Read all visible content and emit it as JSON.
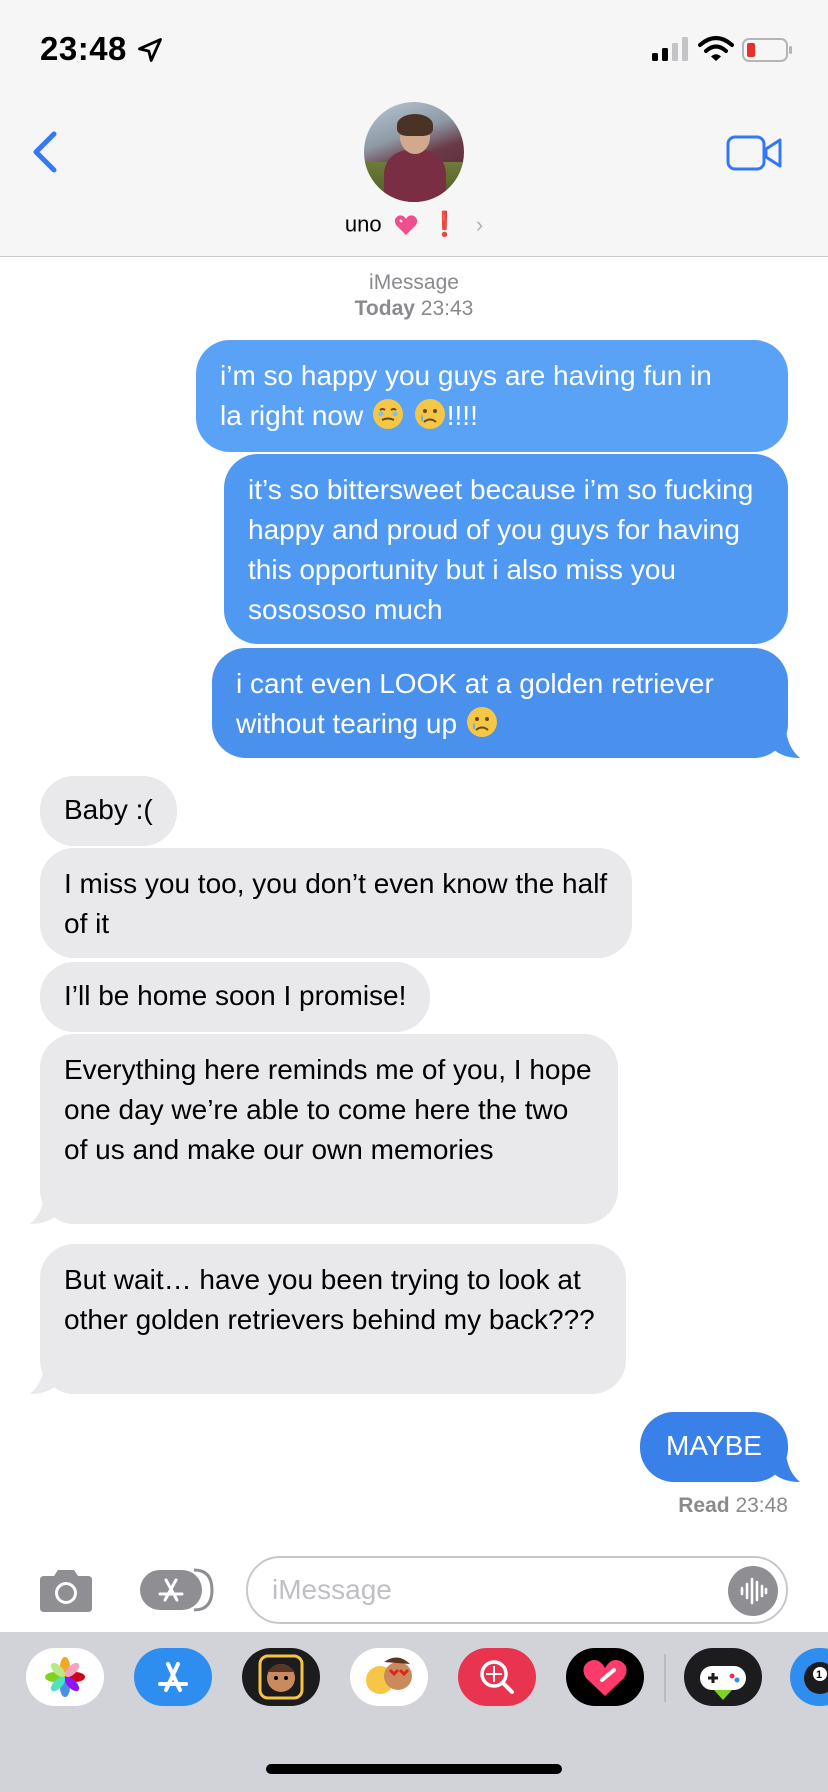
{
  "status_bar": {
    "time": "23:48"
  },
  "header": {
    "contact_name": "uno",
    "emoji_heart": "💖",
    "emoji_exclamation": "❗",
    "chevron": "›"
  },
  "thread": {
    "service": "iMessage",
    "date_label": "Today",
    "date_time": "23:43",
    "messages": [
      {
        "from": "me",
        "parts": [
          "i’m so happy you guys are having fun in",
          "la right now "
        ],
        "trailing": "!!!!"
      },
      {
        "from": "me",
        "text": "it’s so bittersweet because i’m so fucking happy and proud of you guys for having this opportunity but i also miss you sosososo much"
      },
      {
        "from": "me",
        "text": "i cant even LOOK at a golden retriever without tearing up "
      },
      {
        "from": "them",
        "text": "Baby :("
      },
      {
        "from": "them",
        "text": "I miss you too, you don’t even know the half of it"
      },
      {
        "from": "them",
        "text": "I’ll be home soon I promise!"
      },
      {
        "from": "them",
        "text": "Everything here reminds me of you, I hope one day we’re able to come here the two of us and make our own memories"
      },
      {
        "from": "them",
        "text": "But wait… have you been trying to look at other golden retrievers behind my back???"
      },
      {
        "from": "me",
        "text": "MAYBE"
      }
    ],
    "read_label": "Read",
    "read_time": "23:48"
  },
  "input": {
    "placeholder": "iMessage"
  },
  "drawer": {
    "apps": [
      "photos-icon",
      "app-store-icon",
      "memoji-icon",
      "animoji-stickers-icon",
      "image-search-icon",
      "digital-touch-icon",
      "game-pigeon-icon",
      "pool-game-icon"
    ],
    "badge": "1"
  },
  "colors": {
    "accent": "#3478f6",
    "sent_bubble": "#4d96f0",
    "received_bubble": "#e9e9eb"
  }
}
